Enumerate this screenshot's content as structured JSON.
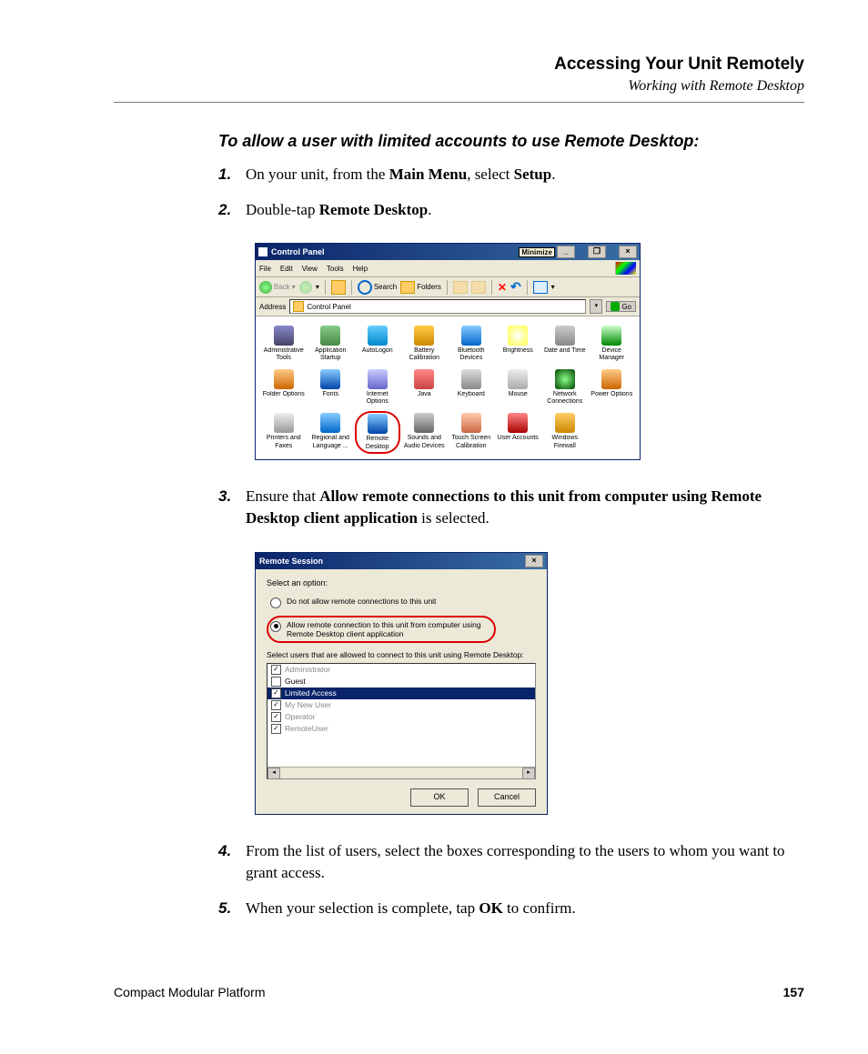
{
  "header": {
    "title": "Accessing Your Unit Remotely",
    "subtitle": "Working with Remote Desktop"
  },
  "section_title": "To allow a user with limited accounts to use Remote Desktop:",
  "steps": {
    "s1": {
      "num": "1.",
      "pre": "On your unit, from the ",
      "b1": "Main Menu",
      "mid": ", select ",
      "b2": "Setup",
      "post": "."
    },
    "s2": {
      "num": "2.",
      "pre": "Double-tap ",
      "b1": "Remote Desktop",
      "post": "."
    },
    "s3": {
      "num": "3.",
      "pre": "Ensure that ",
      "b1": "Allow remote connections to this unit from computer using Remote Desktop client application",
      "post": " is selected."
    },
    "s4": {
      "num": "4.",
      "text": "From the list of users, select the boxes corresponding to the users to whom you want to grant access."
    },
    "s5": {
      "num": "5.",
      "pre": "When your selection is complete, tap ",
      "b1": "OK",
      "post": " to confirm."
    }
  },
  "control_panel": {
    "title": "Control Panel",
    "minimize_hint": "Minimize",
    "menu": {
      "file": "File",
      "edit": "Edit",
      "view": "View",
      "tools": "Tools",
      "help": "Help"
    },
    "toolbar": {
      "back": "Back",
      "search": "Search",
      "folders": "Folders"
    },
    "address_label": "Address",
    "address_value": "Control Panel",
    "go": "Go",
    "items": [
      "Administrative Tools",
      "Application Startup",
      "AutoLogon",
      "Battery Calibration",
      "Bluetooth Devices",
      "Brightness",
      "Date and Time",
      "Device Manager",
      "Folder Options",
      "Fonts",
      "Internet Options",
      "Java",
      "Keyboard",
      "Mouse",
      "Network Connections",
      "Power Options",
      "Printers and Faxes",
      "Regional and Language ...",
      "Remote Desktop",
      "Sounds and Audio Devices",
      "Touch Screen Calibration",
      "User Accounts",
      "Windows Firewall"
    ]
  },
  "remote_session": {
    "title": "Remote Session",
    "prompt": "Select an option:",
    "opt1": "Do not allow remote connections to this unit",
    "opt2": "Allow remote connection to this unit from computer using Remote Desktop client application",
    "users_prompt": "Select users that are allowed to connect to this unit using Remote Desktop:",
    "users": [
      "Administrator",
      "Guest",
      "Limited Access",
      "My New User",
      "Operator",
      "RemoteUser"
    ],
    "ok": "OK",
    "cancel": "Cancel"
  },
  "footer": {
    "left": "Compact Modular Platform",
    "page": "157"
  }
}
